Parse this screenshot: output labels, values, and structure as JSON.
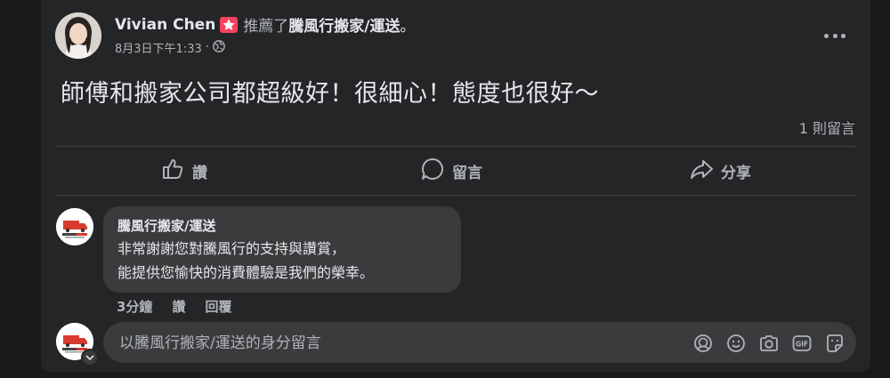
{
  "post": {
    "author": "Vivian Chen",
    "verb": "推薦了",
    "page": "騰風行搬家/運送",
    "period": "。",
    "timestamp": "8月3日下午1:33",
    "separator": "·",
    "text": "師傅和搬家公司都超級好！很細心！態度也很好～",
    "comment_count": "1 則留言"
  },
  "actions": {
    "like": "讚",
    "comment": "留言",
    "share": "分享"
  },
  "comment": {
    "author": "騰風行搬家/運送",
    "line1": "非常謝謝您對騰風行的支持與讚賞，",
    "line2": "能提供您愉快的消費體驗是我們的榮幸。",
    "time": "3分鐘",
    "like": "讚",
    "reply": "回覆"
  },
  "composer": {
    "placeholder": "以騰風行搬家/運送的身分留言"
  },
  "colors": {
    "background": "#18191a",
    "card": "#242526",
    "bubble": "#3a3b3c",
    "recommend_badge": "#f3425f",
    "logo_red": "#d93b30"
  },
  "icons": [
    "recommend-star-icon",
    "globe-icon",
    "more-icon",
    "like-icon",
    "comment-icon",
    "share-icon",
    "avatar-icon",
    "emoji-icon",
    "camera-icon",
    "gif-icon",
    "sticker-icon",
    "chevron-down-icon"
  ]
}
